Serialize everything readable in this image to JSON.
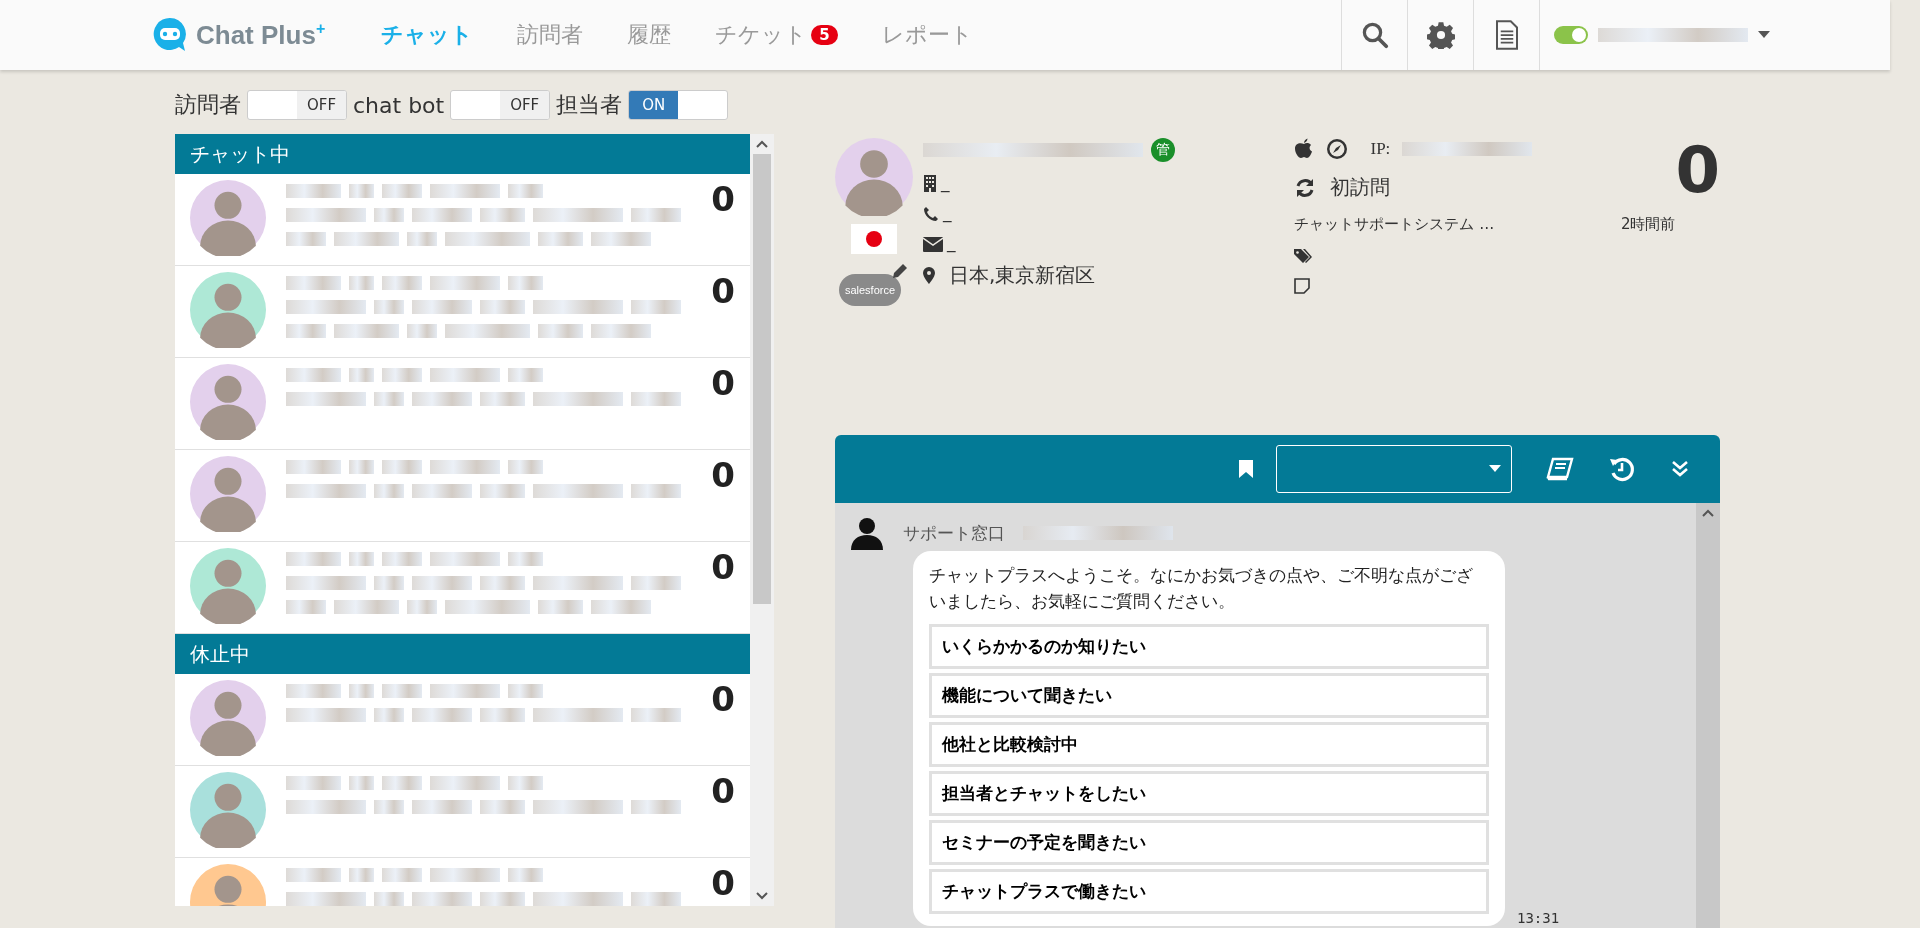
{
  "header": {
    "logo": "Chat Plus$^{+}$",
    "nav": [
      {
        "label": "チャット",
        "selected": true
      },
      {
        "label": "訪問者",
        "selected": false
      },
      {
        "label": "履歴",
        "selected": false
      },
      {
        "label": "チケット",
        "selected": false,
        "badge": "5"
      },
      {
        "label": "レポート",
        "selected": false
      }
    ],
    "status_on": true
  },
  "filters": [
    {
      "label": "訪問者",
      "on": false,
      "state": "OFF"
    },
    {
      "label": "chat bot",
      "on": false,
      "state": "OFF"
    },
    {
      "label": "担当者",
      "on": true,
      "state": "ON"
    }
  ],
  "sessions": [
    {
      "title": "チャット中",
      "rows": [
        {
          "color": "#e3d0ec",
          "count": "0"
        },
        {
          "color": "#aee8d6",
          "count": "0"
        },
        {
          "color": "#e3d0ec",
          "count": "0"
        },
        {
          "color": "#e3d0ec",
          "count": "0"
        },
        {
          "color": "#aee8d6",
          "count": "0"
        }
      ]
    },
    {
      "title": "休止中",
      "rows": [
        {
          "color": "#e3d0ec",
          "count": "0"
        },
        {
          "color": "#a9e0dc",
          "count": "0"
        },
        {
          "color": "#ffc890",
          "count": "0"
        }
      ]
    }
  ],
  "visitor": {
    "badge": "管",
    "crm_label": "salesforce",
    "company": "_",
    "phone": "_",
    "email": "_",
    "location": "日本,東京新宿区",
    "ip_label": "IP:",
    "visit": "初訪問",
    "referrer": "チャットサポートシステム …",
    "time": "2時間前",
    "count": "0"
  },
  "chat": {
    "agent": "サポート窓口",
    "message": "チャットプラスへようこそ。なにかお気づきの点や、ご不明な点がございましたら、お気軽にご質問ください。",
    "options": [
      "いくらかかるのか知りたい",
      "機能について聞きたい",
      "他社と比較検討中",
      "担当者とチャットをしたい",
      "セミナーの予定を聞きたい",
      "チャットプラスで働きたい"
    ],
    "time": "13:31"
  }
}
